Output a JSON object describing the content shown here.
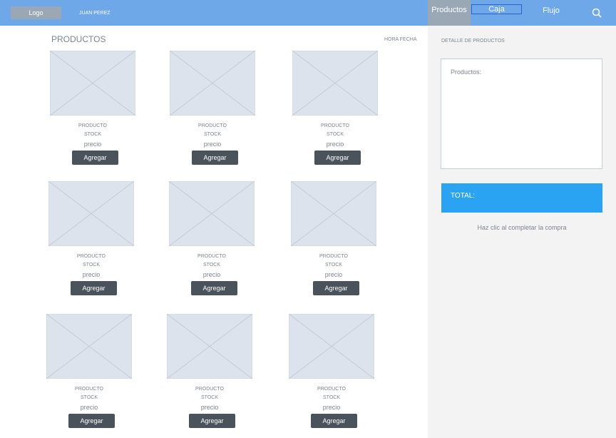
{
  "header": {
    "logo": "Logo",
    "user": "JUAN PEREZ",
    "tabs": [
      {
        "label": "Productos"
      },
      {
        "label": "Caja"
      },
      {
        "label": "Flujo"
      }
    ],
    "search_icon": "search-icon"
  },
  "main": {
    "title": "PRODUCTOS",
    "datetime": "HORA FECHA",
    "products": [
      {
        "name": "PRODUCTO",
        "stock": "STOCK",
        "price": "precio",
        "button": "Agregar"
      },
      {
        "name": "PRODUCTO",
        "stock": "STOCK",
        "price": "precio",
        "button": "Agregar"
      },
      {
        "name": "PRODUCTO",
        "stock": "STOCK",
        "price": "precio",
        "button": "Agregar"
      },
      {
        "name": "PRODUCTO",
        "stock": "STOCK",
        "price": "precio",
        "button": "Agregar"
      },
      {
        "name": "PRODUCTO",
        "stock": "STOCK",
        "price": "precio",
        "button": "Agregar"
      },
      {
        "name": "PRODUCTO",
        "stock": "STOCK",
        "price": "precio",
        "button": "Agregar"
      },
      {
        "name": "PRODUCTO",
        "stock": "STOCK",
        "price": "precio",
        "button": "Agregar"
      },
      {
        "name": "PRODUCTO",
        "stock": "STOCK",
        "price": "precio",
        "button": "Agregar"
      },
      {
        "name": "PRODUCTO",
        "stock": "STOCK",
        "price": "precio",
        "button": "Agregar"
      }
    ]
  },
  "sidebar": {
    "title": "DETALLE  DE PRODUCTOS",
    "detail_label": "Productos:",
    "total_label": "TOTAL:",
    "hint": "Haz clic al completar la compra"
  },
  "colors": {
    "topbar": "#6fa8e8",
    "active_tab": "#9aa8b6",
    "button": "#4a525c",
    "total": "#2aa3f2"
  }
}
